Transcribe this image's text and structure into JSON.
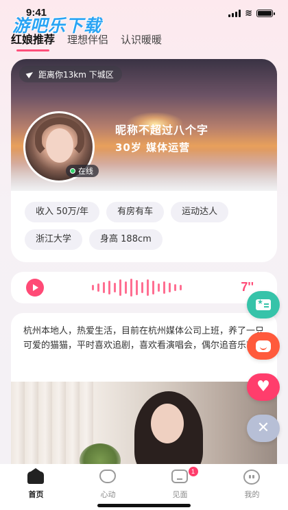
{
  "status_bar": {
    "time": "9:41"
  },
  "watermark": "游吧乐下载",
  "tabs": [
    {
      "label": "红娘推荐",
      "active": true
    },
    {
      "label": "理想伴侣",
      "active": false
    },
    {
      "label": "认识暖暖",
      "active": false
    }
  ],
  "profile": {
    "distance": "距离你13km 下城区",
    "online_label": "在线",
    "nickname": "昵称不超过八个字",
    "age_job": "30岁 媒体运营",
    "tags": [
      "收入 50万/年",
      "有房有车",
      "运动达人",
      "浙江大学",
      "身高 188cm"
    ]
  },
  "voice": {
    "duration": "7''",
    "accent_color": "#ff4a76"
  },
  "bio": {
    "text": "杭州本地人，热爱生活，目前在杭州媒体公司上班，养了一只可爱的猫猫，平时喜欢追剧，喜欢看演唱会，偶尔追音乐节。"
  },
  "actions": [
    {
      "icon": "card-icon",
      "color": "#36c3a9"
    },
    {
      "icon": "chat-icon",
      "color": "#ff5a3c"
    },
    {
      "icon": "heart-icon",
      "glyph": "♥",
      "color": "#ff3d6c"
    },
    {
      "icon": "close-icon",
      "glyph": "✕",
      "color": "#b7bfd6"
    }
  ],
  "bottom_nav": [
    {
      "label": "首页",
      "icon": "home-icon",
      "active": true
    },
    {
      "label": "心动",
      "icon": "heartbeat-icon",
      "active": false
    },
    {
      "label": "见面",
      "icon": "meet-icon",
      "active": false,
      "badge": "1"
    },
    {
      "label": "我的",
      "icon": "profile-icon",
      "active": false
    }
  ]
}
